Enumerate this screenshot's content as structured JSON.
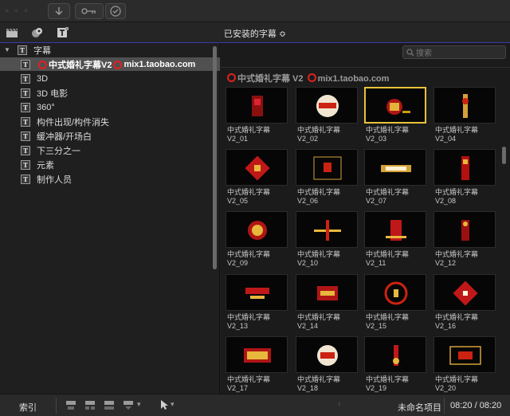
{
  "toolbar": {
    "download_icon": "arrow-down-icon",
    "key_icon": "key-icon",
    "check_icon": "checkmark-icon"
  },
  "header": {
    "title": "已安装的字幕 ≎"
  },
  "sidebar": {
    "root_label": "字幕",
    "items": [
      {
        "label_pre": "",
        "label_mid": "中式婚礼字幕V2 ",
        "label_post": "mix1.taobao.com",
        "selected": true,
        "has_logo": true
      },
      {
        "label": "3D"
      },
      {
        "label": "3D 电影"
      },
      {
        "label": "360°"
      },
      {
        "label": "构件出现/构件消失"
      },
      {
        "label": "缓冲器/开场白"
      },
      {
        "label": "下三分之一"
      },
      {
        "label": "元素"
      },
      {
        "label": "制作人员"
      }
    ]
  },
  "search": {
    "placeholder": "搜索"
  },
  "section": {
    "label_a": "中式婚礼字幕 V2 ",
    "label_b": "mix1.taobao.com"
  },
  "thumbnails": [
    {
      "name": "中式婚礼字幕",
      "id": "V2_01"
    },
    {
      "name": "中式婚礼字幕",
      "id": "V2_02"
    },
    {
      "name": "中式婚礼字幕",
      "id": "V2_03",
      "selected": true
    },
    {
      "name": "中式婚礼字幕",
      "id": "V2_04"
    },
    {
      "name": "中式婚礼字幕",
      "id": "V2_05"
    },
    {
      "name": "中式婚礼字幕",
      "id": "V2_06"
    },
    {
      "name": "中式婚礼字幕",
      "id": "V2_07"
    },
    {
      "name": "中式婚礼字幕",
      "id": "V2_08"
    },
    {
      "name": "中式婚礼字幕",
      "id": "V2_09"
    },
    {
      "name": "中式婚礼字幕",
      "id": "V2_10"
    },
    {
      "name": "中式婚礼字幕",
      "id": "V2_11"
    },
    {
      "name": "中式婚礼字幕",
      "id": "V2_12"
    },
    {
      "name": "中式婚礼字幕",
      "id": "V2_13"
    },
    {
      "name": "中式婚礼字幕",
      "id": "V2_14"
    },
    {
      "name": "中式婚礼字幕",
      "id": "V2_15"
    },
    {
      "name": "中式婚礼字幕",
      "id": "V2_16"
    },
    {
      "name": "中式婚礼字幕",
      "id": "V2_17"
    },
    {
      "name": "中式婚礼字幕",
      "id": "V2_18"
    },
    {
      "name": "中式婚礼字幕",
      "id": "V2_19"
    },
    {
      "name": "中式婚礼字幕",
      "id": "V2_20"
    }
  ],
  "bottombar": {
    "index_label": "索引",
    "project_name": "未命名项目",
    "timecode": "08:20 / 08:20"
  },
  "colors": {
    "accent_red": "#e02020",
    "selection_yellow": "#e9c23a",
    "header_blue_line": "#3a3aa8"
  }
}
